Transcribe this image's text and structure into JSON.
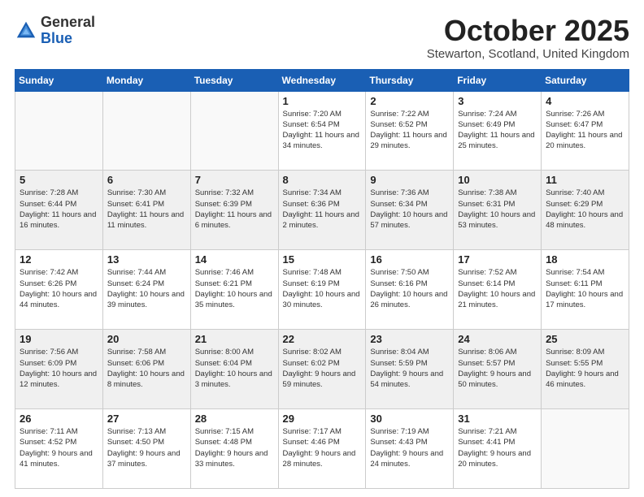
{
  "header": {
    "logo_general": "General",
    "logo_blue": "Blue",
    "month": "October 2025",
    "location": "Stewarton, Scotland, United Kingdom"
  },
  "days_of_week": [
    "Sunday",
    "Monday",
    "Tuesday",
    "Wednesday",
    "Thursday",
    "Friday",
    "Saturday"
  ],
  "weeks": [
    {
      "shaded": false,
      "days": [
        {
          "num": "",
          "text": ""
        },
        {
          "num": "",
          "text": ""
        },
        {
          "num": "",
          "text": ""
        },
        {
          "num": "1",
          "text": "Sunrise: 7:20 AM\nSunset: 6:54 PM\nDaylight: 11 hours\nand 34 minutes."
        },
        {
          "num": "2",
          "text": "Sunrise: 7:22 AM\nSunset: 6:52 PM\nDaylight: 11 hours\nand 29 minutes."
        },
        {
          "num": "3",
          "text": "Sunrise: 7:24 AM\nSunset: 6:49 PM\nDaylight: 11 hours\nand 25 minutes."
        },
        {
          "num": "4",
          "text": "Sunrise: 7:26 AM\nSunset: 6:47 PM\nDaylight: 11 hours\nand 20 minutes."
        }
      ]
    },
    {
      "shaded": true,
      "days": [
        {
          "num": "5",
          "text": "Sunrise: 7:28 AM\nSunset: 6:44 PM\nDaylight: 11 hours\nand 16 minutes."
        },
        {
          "num": "6",
          "text": "Sunrise: 7:30 AM\nSunset: 6:41 PM\nDaylight: 11 hours\nand 11 minutes."
        },
        {
          "num": "7",
          "text": "Sunrise: 7:32 AM\nSunset: 6:39 PM\nDaylight: 11 hours\nand 6 minutes."
        },
        {
          "num": "8",
          "text": "Sunrise: 7:34 AM\nSunset: 6:36 PM\nDaylight: 11 hours\nand 2 minutes."
        },
        {
          "num": "9",
          "text": "Sunrise: 7:36 AM\nSunset: 6:34 PM\nDaylight: 10 hours\nand 57 minutes."
        },
        {
          "num": "10",
          "text": "Sunrise: 7:38 AM\nSunset: 6:31 PM\nDaylight: 10 hours\nand 53 minutes."
        },
        {
          "num": "11",
          "text": "Sunrise: 7:40 AM\nSunset: 6:29 PM\nDaylight: 10 hours\nand 48 minutes."
        }
      ]
    },
    {
      "shaded": false,
      "days": [
        {
          "num": "12",
          "text": "Sunrise: 7:42 AM\nSunset: 6:26 PM\nDaylight: 10 hours\nand 44 minutes."
        },
        {
          "num": "13",
          "text": "Sunrise: 7:44 AM\nSunset: 6:24 PM\nDaylight: 10 hours\nand 39 minutes."
        },
        {
          "num": "14",
          "text": "Sunrise: 7:46 AM\nSunset: 6:21 PM\nDaylight: 10 hours\nand 35 minutes."
        },
        {
          "num": "15",
          "text": "Sunrise: 7:48 AM\nSunset: 6:19 PM\nDaylight: 10 hours\nand 30 minutes."
        },
        {
          "num": "16",
          "text": "Sunrise: 7:50 AM\nSunset: 6:16 PM\nDaylight: 10 hours\nand 26 minutes."
        },
        {
          "num": "17",
          "text": "Sunrise: 7:52 AM\nSunset: 6:14 PM\nDaylight: 10 hours\nand 21 minutes."
        },
        {
          "num": "18",
          "text": "Sunrise: 7:54 AM\nSunset: 6:11 PM\nDaylight: 10 hours\nand 17 minutes."
        }
      ]
    },
    {
      "shaded": true,
      "days": [
        {
          "num": "19",
          "text": "Sunrise: 7:56 AM\nSunset: 6:09 PM\nDaylight: 10 hours\nand 12 minutes."
        },
        {
          "num": "20",
          "text": "Sunrise: 7:58 AM\nSunset: 6:06 PM\nDaylight: 10 hours\nand 8 minutes."
        },
        {
          "num": "21",
          "text": "Sunrise: 8:00 AM\nSunset: 6:04 PM\nDaylight: 10 hours\nand 3 minutes."
        },
        {
          "num": "22",
          "text": "Sunrise: 8:02 AM\nSunset: 6:02 PM\nDaylight: 9 hours\nand 59 minutes."
        },
        {
          "num": "23",
          "text": "Sunrise: 8:04 AM\nSunset: 5:59 PM\nDaylight: 9 hours\nand 54 minutes."
        },
        {
          "num": "24",
          "text": "Sunrise: 8:06 AM\nSunset: 5:57 PM\nDaylight: 9 hours\nand 50 minutes."
        },
        {
          "num": "25",
          "text": "Sunrise: 8:09 AM\nSunset: 5:55 PM\nDaylight: 9 hours\nand 46 minutes."
        }
      ]
    },
    {
      "shaded": false,
      "days": [
        {
          "num": "26",
          "text": "Sunrise: 7:11 AM\nSunset: 4:52 PM\nDaylight: 9 hours\nand 41 minutes."
        },
        {
          "num": "27",
          "text": "Sunrise: 7:13 AM\nSunset: 4:50 PM\nDaylight: 9 hours\nand 37 minutes."
        },
        {
          "num": "28",
          "text": "Sunrise: 7:15 AM\nSunset: 4:48 PM\nDaylight: 9 hours\nand 33 minutes."
        },
        {
          "num": "29",
          "text": "Sunrise: 7:17 AM\nSunset: 4:46 PM\nDaylight: 9 hours\nand 28 minutes."
        },
        {
          "num": "30",
          "text": "Sunrise: 7:19 AM\nSunset: 4:43 PM\nDaylight: 9 hours\nand 24 minutes."
        },
        {
          "num": "31",
          "text": "Sunrise: 7:21 AM\nSunset: 4:41 PM\nDaylight: 9 hours\nand 20 minutes."
        },
        {
          "num": "",
          "text": ""
        }
      ]
    }
  ]
}
